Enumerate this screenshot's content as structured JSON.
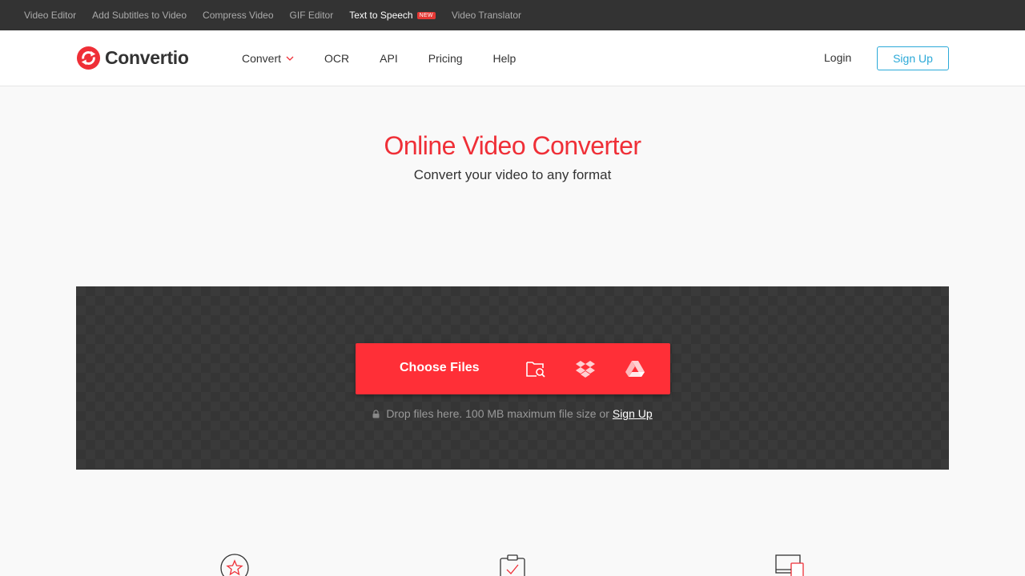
{
  "topbar": {
    "links": [
      {
        "label": "Video Editor"
      },
      {
        "label": "Add Subtitles to Video"
      },
      {
        "label": "Compress Video"
      },
      {
        "label": "GIF Editor"
      },
      {
        "label": "Text to Speech",
        "badge": "NEW"
      },
      {
        "label": "Video Translator"
      }
    ]
  },
  "header": {
    "brand": "Convertio",
    "nav": [
      "Convert",
      "OCR",
      "API",
      "Pricing",
      "Help"
    ],
    "login": "Login",
    "signup": "Sign Up"
  },
  "hero": {
    "title": "Online Video Converter",
    "subtitle": "Convert your video to any format"
  },
  "upload": {
    "choose_label": "Choose Files",
    "source_icons": [
      "folder-search-icon",
      "dropbox-icon",
      "google-drive-icon"
    ],
    "drop_text": "Drop files here. 100 MB maximum file size or",
    "drop_link": "Sign Up"
  },
  "features": {
    "icons": [
      "star-icon",
      "clipboard-check-icon",
      "devices-icon"
    ]
  },
  "colors": {
    "accent_red": "#ff2f37",
    "title_red": "#ef2f37",
    "signup_blue": "#2ba9d8",
    "topbar_bg": "#333333"
  }
}
